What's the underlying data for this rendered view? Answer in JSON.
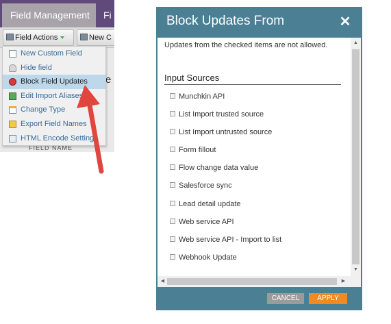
{
  "app": {
    "active_tab": "Field Management",
    "next_tab": "Fi",
    "toolbar": {
      "field_actions_label": "Field Actions",
      "new_button_label": "New C"
    },
    "background_peek": "e",
    "background_peek_bottom": "FIELD NAME"
  },
  "menu": {
    "items": [
      {
        "label": "New Custom Field",
        "icon": "new-document-icon"
      },
      {
        "label": "Hide field",
        "icon": "hide-icon"
      },
      {
        "label": "Block Field Updates",
        "icon": "block-icon"
      },
      {
        "label": "Edit Import Aliases",
        "icon": "edit-icon"
      },
      {
        "label": "Change Type",
        "icon": "change-type-icon"
      },
      {
        "label": "Export Field Names",
        "icon": "export-icon"
      },
      {
        "label": "HTML Encode Settings",
        "icon": "html-encode-icon"
      }
    ],
    "highlighted_index": 2
  },
  "dialog": {
    "title": "Block Updates From",
    "close_symbol": "✕",
    "description": "Updates from the checked items are not allowed.",
    "section_title": "Input Sources",
    "options": [
      {
        "label": "Munchkin API",
        "checked": false
      },
      {
        "label": "List Import trusted source",
        "checked": false
      },
      {
        "label": "List Import untrusted source",
        "checked": false
      },
      {
        "label": "Form fillout",
        "checked": false
      },
      {
        "label": "Flow change data value",
        "checked": false
      },
      {
        "label": "Salesforce sync",
        "checked": false
      },
      {
        "label": "Lead detail update",
        "checked": false
      },
      {
        "label": "Web service API",
        "checked": false
      },
      {
        "label": "Web service API - Import to list",
        "checked": false
      },
      {
        "label": "Webhook Update",
        "checked": false
      }
    ],
    "cancel_label": "CANCEL",
    "apply_label": "APPLY"
  },
  "colors": {
    "dialog_header": "#4b7f94",
    "apply_button": "#f08a24",
    "cancel_button": "#9b9b9b",
    "tab_bar": "#5f4a7b",
    "menu_highlight": "#bdd8eb",
    "arrow": "#e0453e"
  }
}
